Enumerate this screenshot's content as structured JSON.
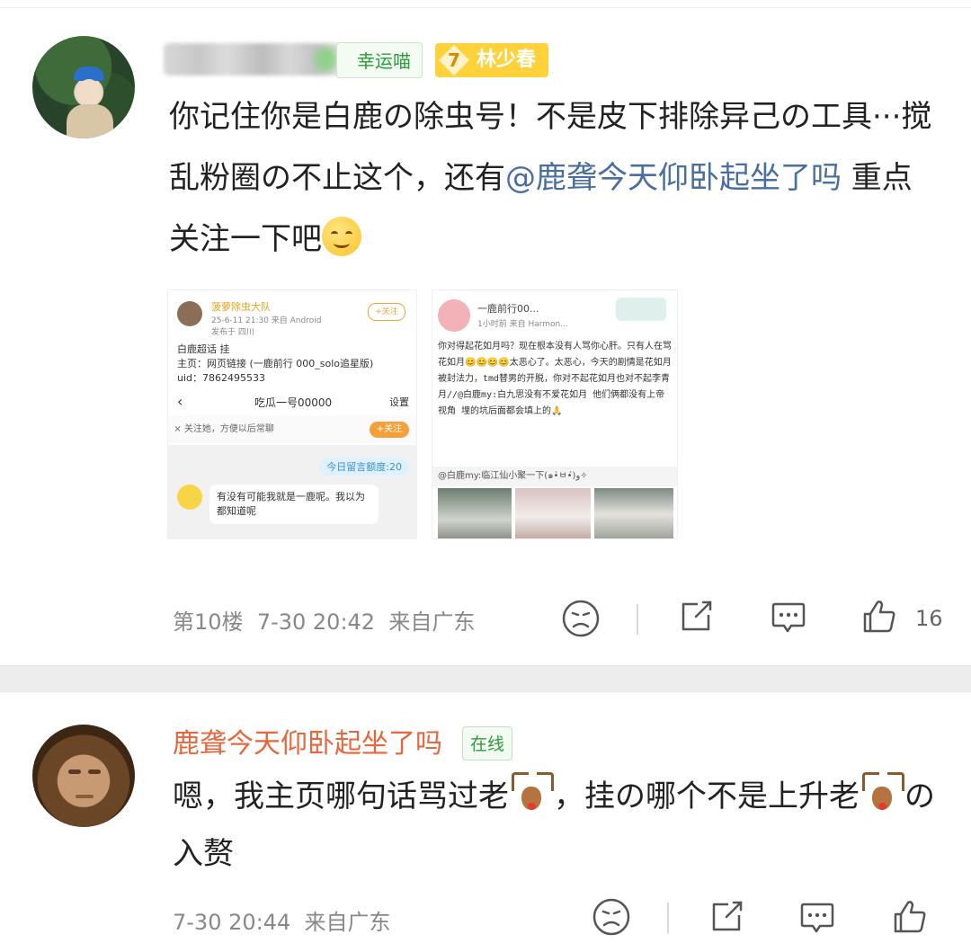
{
  "comment1": {
    "user_badge": "幸运喵",
    "fan_level": "7",
    "fan_badge": "林少春",
    "text_a": "你记住你是白鹿の除虫号！不是皮下排除异己の工具···搅乱粉圈の不止这个，还有",
    "mention": "@鹿聋今天仰卧起坐了吗",
    "text_b": " 重点关注一下吧",
    "emoji": "smile-emoji",
    "image1": {
      "name": "菠萝除虫大队",
      "meta": "25-6-11 21:30 来自 Android",
      "loc": "发布于 四川",
      "follow": "+关注",
      "line1": "白鹿超话 挂",
      "line2": "主页：网页链接 (一鹿前行 000_solo追星版)",
      "line3": "uid：7862495533",
      "chat_title": "吃瓜一号00000",
      "chat_settings": "设置",
      "notice": "关注她，方便以后常聊",
      "notice_btn": "+关注",
      "quota": "今日留言额度:20",
      "bubble": "有没有可能我就是一鹿呢。我以为都知道呢"
    },
    "image2": {
      "name": "一鹿前行00...",
      "meta": "1小时前  来自 Harmon...",
      "handwriting": "你对得起花如月吗？现在根本没有人骂你心肝。只有人在骂花如月😊😊😊😊太恶心了。太恶心，今天的剧情是花如月被封法力，tmd替男的开脱，你对不起花如月也对不起李青月//@白鹿my:白九思没有不爱花如月 他们俩都没有上帝视角 埋的坑后面都会填上的🙏",
      "sub": "@白鹿my:临江仙小聚一下(๑•̀ㅂ•́)و✧"
    },
    "footer": {
      "floor": "第10楼",
      "time": "7-30 20:42",
      "location": "来自广东",
      "likes": "16"
    }
  },
  "comment2": {
    "username": "鹿聋今天仰卧起坐了吗",
    "online": "在线",
    "text_a": "嗯，我主页哪句话骂过老",
    "text_b": "，挂の哪个不是上升老",
    "text_c": "の入赘",
    "emoji": "deer-emoji",
    "footer": {
      "time": "7-30 20:44",
      "location": "来自广东"
    }
  }
}
